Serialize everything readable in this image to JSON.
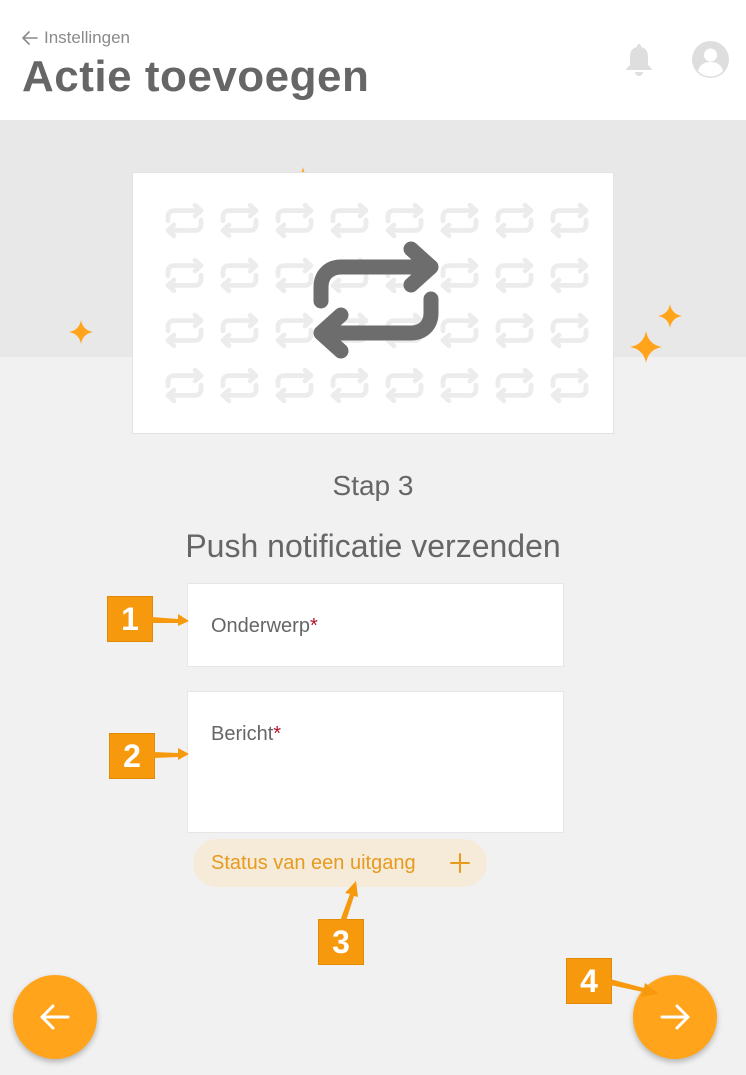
{
  "header": {
    "back_label": "Instellingen",
    "title": "Actie toevoegen",
    "icons": [
      "arrow-left-icon",
      "bell-icon",
      "user-avatar-icon"
    ]
  },
  "illustration": {
    "icon": "repeat-arrows-icon",
    "accent_color": "#ffa41b"
  },
  "step": {
    "label": "Stap 3",
    "title": "Push notificatie verzenden"
  },
  "form": {
    "subject_label": "Onderwerp",
    "message_label": "Bericht",
    "required_mark": "*",
    "add_condition_label": "Status van een uitgang",
    "add_condition_icon": "plus-icon"
  },
  "navigation": {
    "prev_icon": "arrow-left-icon",
    "next_icon": "arrow-right-icon"
  },
  "annotations": {
    "markers": [
      "1",
      "2",
      "3",
      "4"
    ],
    "color": "#f7990d"
  }
}
